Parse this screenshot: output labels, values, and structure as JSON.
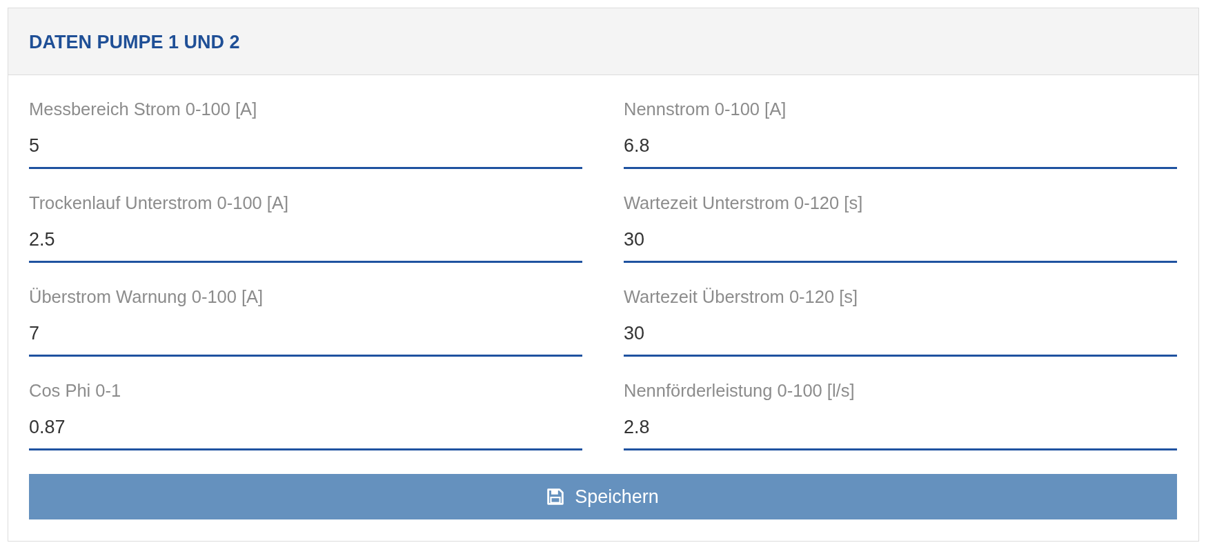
{
  "panel": {
    "title": "DATEN PUMPE 1 UND 2",
    "fields": [
      {
        "label": "Messbereich Strom 0-100 [A]",
        "value": "5"
      },
      {
        "label": "Nennstrom 0-100 [A]",
        "value": "6.8"
      },
      {
        "label": "Trockenlauf Unterstrom 0-100 [A]",
        "value": "2.5"
      },
      {
        "label": "Wartezeit Unterstrom 0-120 [s]",
        "value": "30"
      },
      {
        "label": "Überstrom Warnung 0-100 [A]",
        "value": "7"
      },
      {
        "label": "Wartezeit Überstrom 0-120 [s]",
        "value": "30"
      },
      {
        "label": "Cos Phi 0-1",
        "value": "0.87"
      },
      {
        "label": "Nennförderleistung 0-100 [l/s]",
        "value": "2.8"
      }
    ],
    "save_button": {
      "label": "Speichern"
    }
  }
}
